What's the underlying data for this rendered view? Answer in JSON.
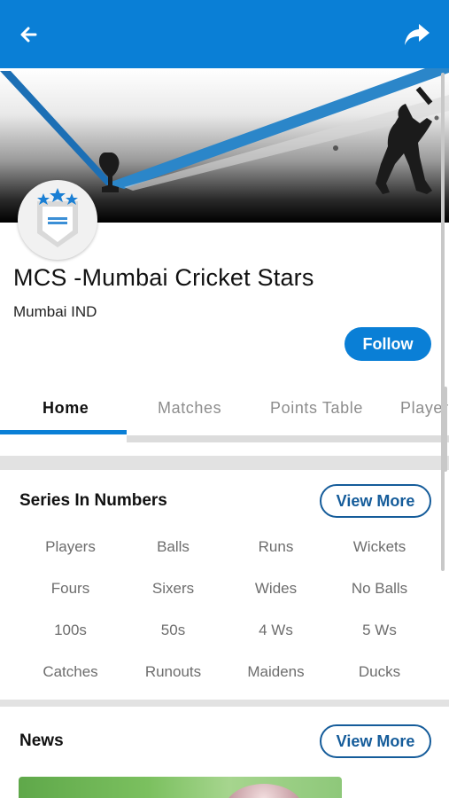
{
  "app_bar": {
    "back_icon": "arrow-left-icon",
    "share_icon": "share-icon",
    "color": "#0a7fd6"
  },
  "team": {
    "name": "MCS -Mumbai Cricket Stars",
    "location": "Mumbai IND",
    "logo_icon": "shield-stars-icon"
  },
  "follow_button": {
    "label": "Follow"
  },
  "tabs": [
    {
      "label": "Home",
      "active": true
    },
    {
      "label": "Matches",
      "active": false
    },
    {
      "label": "Points Table",
      "active": false
    },
    {
      "label": "Players",
      "active": false
    }
  ],
  "series": {
    "title": "Series In Numbers",
    "view_more": "View More",
    "stats": [
      [
        "Players",
        "Balls",
        "Runs",
        "Wickets"
      ],
      [
        "Fours",
        "Sixers",
        "Wides",
        "No Balls"
      ],
      [
        "100s",
        "50s",
        "4 Ws",
        "5 Ws"
      ],
      [
        "Catches",
        "Runouts",
        "Maidens",
        "Ducks"
      ]
    ]
  },
  "news": {
    "title": "News",
    "view_more": "View More"
  },
  "colors": {
    "accent": "#0a7fd6",
    "outline": "#155c9a"
  }
}
